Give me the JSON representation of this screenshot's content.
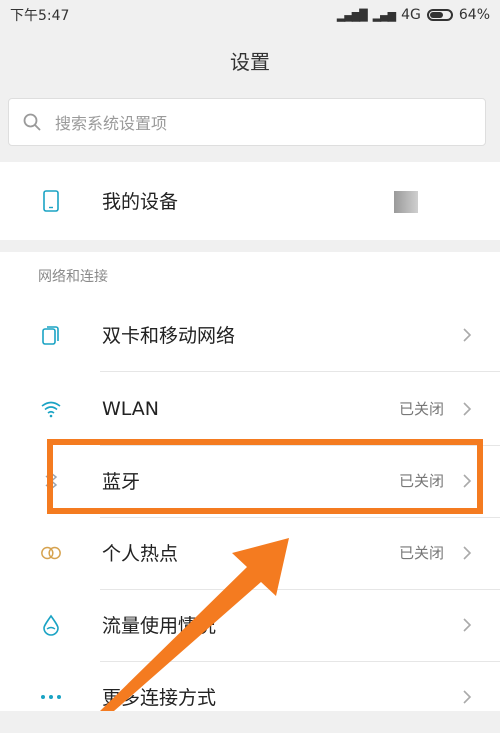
{
  "status_bar": {
    "time": "下午5:47",
    "network": "4G",
    "battery_text": "64%",
    "battery_level": 0.64
  },
  "header": {
    "title": "设置"
  },
  "search": {
    "placeholder": "搜索系统设置项"
  },
  "device": {
    "label": "我的设备"
  },
  "network_section": {
    "title": "网络和连接",
    "items": [
      {
        "label": "双卡和移动网络",
        "value": "",
        "icon": "dual-sim-icon"
      },
      {
        "label": "WLAN",
        "value": "已关闭",
        "icon": "wifi-icon"
      },
      {
        "label": "蓝牙",
        "value": "已关闭",
        "icon": "bluetooth-icon"
      },
      {
        "label": "个人热点",
        "value": "已关闭",
        "icon": "hotspot-icon"
      },
      {
        "label": "流量使用情况",
        "value": "",
        "icon": "data-usage-icon"
      },
      {
        "label": "更多连接方式",
        "value": "",
        "icon": "more-icon"
      }
    ]
  },
  "colors": {
    "highlight": "#f47b20",
    "icon_accent": "#1aa3c4"
  }
}
